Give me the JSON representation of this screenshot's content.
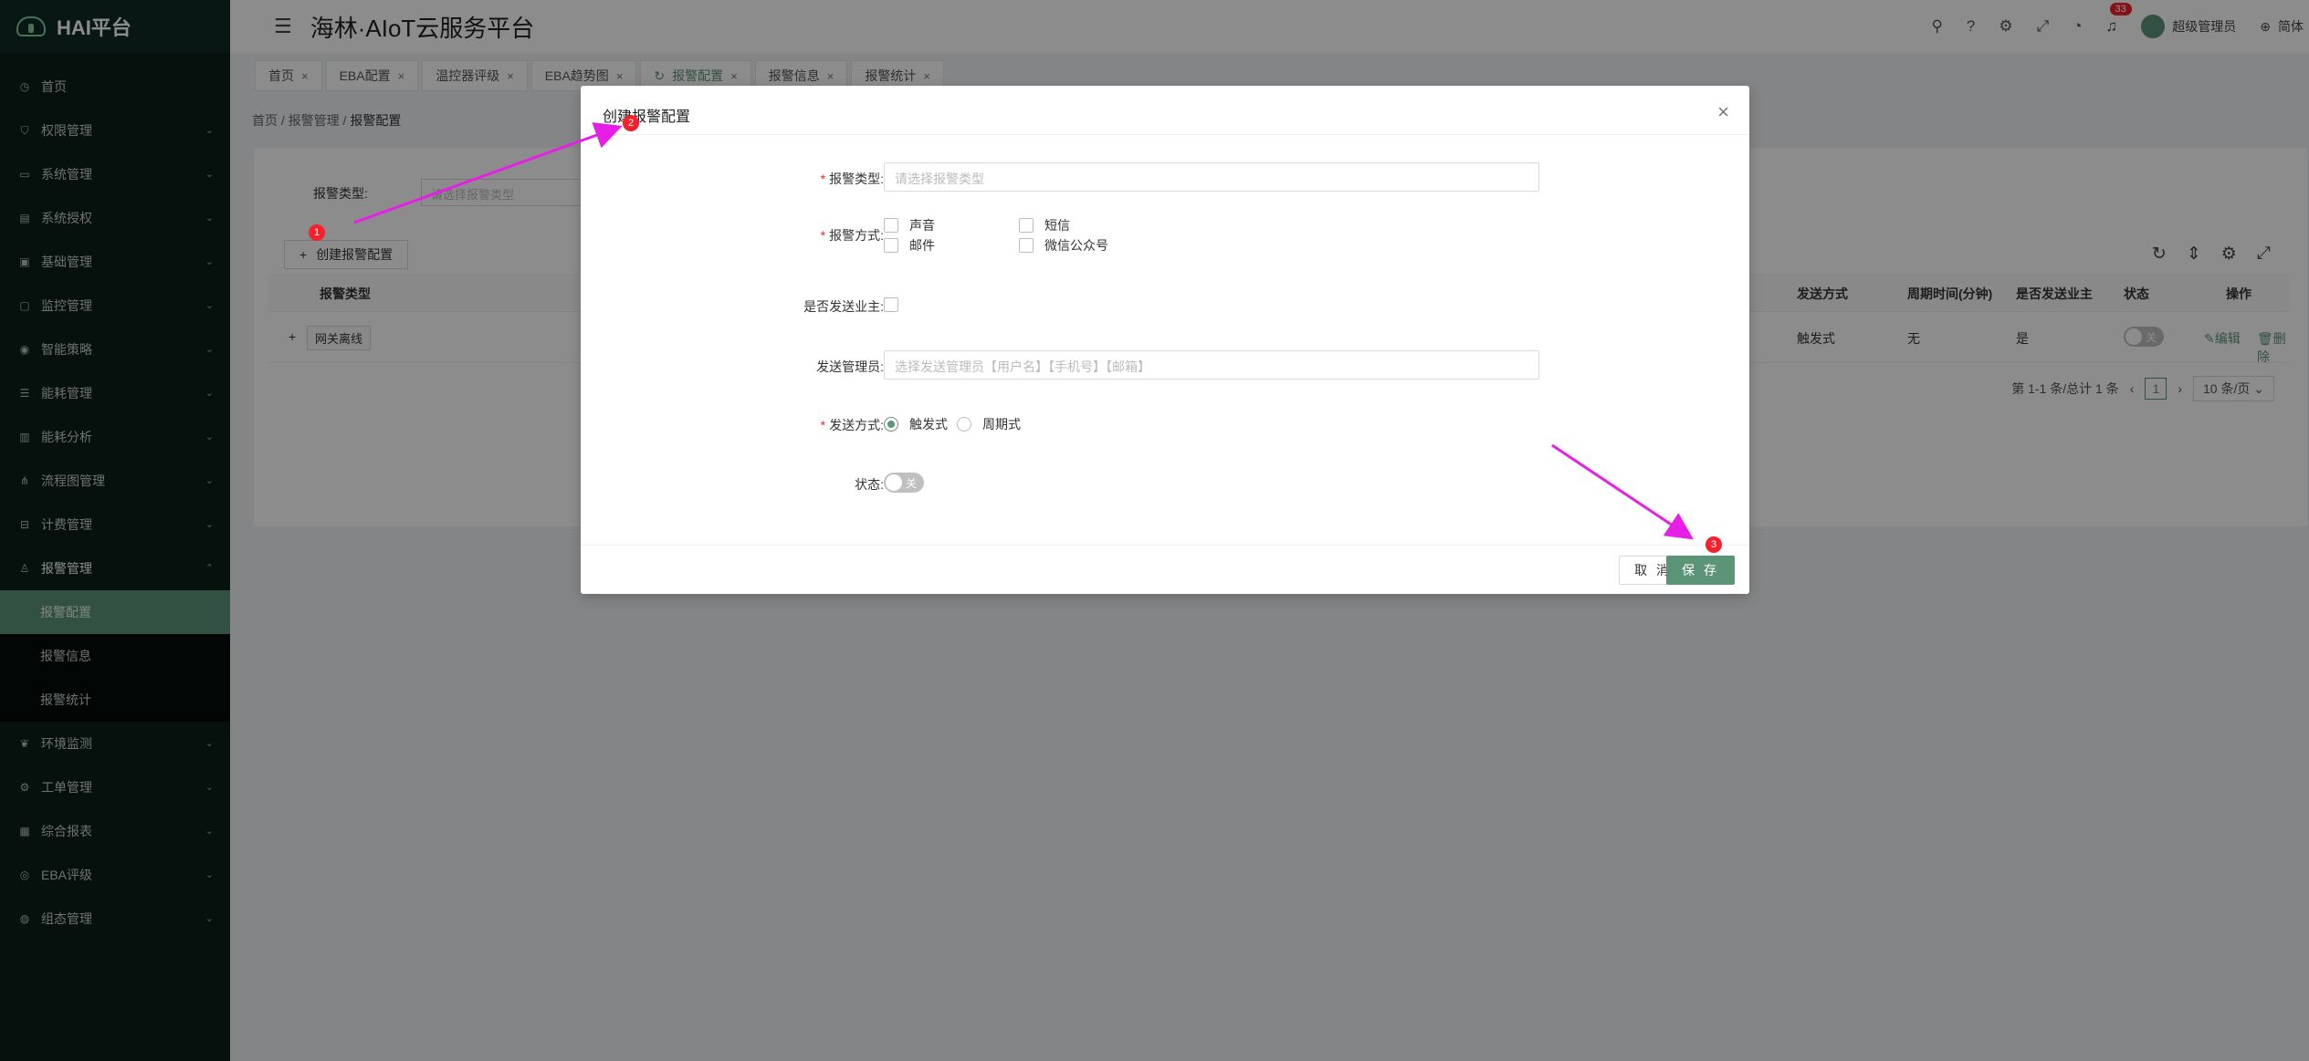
{
  "sidebar": {
    "brand": "HAI平台",
    "items": [
      {
        "label": "首页",
        "icon": "clock-icon",
        "expand": false
      },
      {
        "label": "权限管理",
        "icon": "shield-icon",
        "expand": true
      },
      {
        "label": "系统管理",
        "icon": "monitor-icon",
        "expand": true
      },
      {
        "label": "系统授权",
        "icon": "document-icon",
        "expand": true
      },
      {
        "label": "基础管理",
        "icon": "image-icon",
        "expand": true
      },
      {
        "label": "监控管理",
        "icon": "screen-icon",
        "expand": true
      },
      {
        "label": "智能策略",
        "icon": "bulb-icon",
        "expand": true
      },
      {
        "label": "能耗管理",
        "icon": "sliders-icon",
        "expand": true
      },
      {
        "label": "能耗分析",
        "icon": "bar-chart-icon",
        "expand": true
      },
      {
        "label": "流程图管理",
        "icon": "flow-icon",
        "expand": true
      },
      {
        "label": "计费管理",
        "icon": "money-icon",
        "expand": true
      },
      {
        "label": "报警管理",
        "icon": "alarm-icon",
        "expand": true
      }
    ],
    "sub_items": [
      "报警配置",
      "报警信息",
      "报警统计"
    ],
    "items_after": [
      {
        "label": "环境监测",
        "icon": "leaf-icon"
      },
      {
        "label": "工单管理",
        "icon": "gear-icon"
      },
      {
        "label": "综合报表",
        "icon": "report-icon"
      },
      {
        "label": "EBA评级",
        "icon": "medal-icon"
      },
      {
        "label": "组态管理",
        "icon": "dashboard-icon"
      }
    ]
  },
  "header": {
    "title": "海林·AIoT云服务平台",
    "notification_count": "33",
    "user": "超级管理员",
    "language": "简体"
  },
  "tabs": [
    {
      "label": "首页"
    },
    {
      "label": "EBA配置"
    },
    {
      "label": "温控器评级"
    },
    {
      "label": "EBA趋势图"
    },
    {
      "label": "报警配置",
      "active": true
    },
    {
      "label": "报警信息"
    },
    {
      "label": "报警统计"
    }
  ],
  "breadcrumb": [
    "首页",
    "报警管理",
    "报警配置"
  ],
  "filter": {
    "label": "报警类型:",
    "placeholder": "请选择报警类型"
  },
  "create_button": "创建报警配置",
  "table": {
    "headers": [
      "报警类型",
      "发送方式",
      "周期时间(分钟)",
      "是否发送业主",
      "状态",
      "操作"
    ],
    "row": {
      "expand": "+",
      "type": "网关离线",
      "send_mode": "触发式",
      "period": "无",
      "send_owner": "是",
      "status": "关",
      "edit": "编辑",
      "delete": "删除"
    }
  },
  "pagination": {
    "summary": "第 1-1 条/总计 1 条",
    "page": "1",
    "size": "10 条/页"
  },
  "modal": {
    "title": "创建报警配置",
    "fields": {
      "alarm_type": {
        "label": "报警类型:",
        "placeholder": "请选择报警类型"
      },
      "alarm_method": {
        "label": "报警方式:",
        "options": [
          "声音",
          "短信",
          "邮件",
          "微信公众号"
        ]
      },
      "send_owner": {
        "label": "是否发送业主:"
      },
      "send_admin": {
        "label": "发送管理员:",
        "placeholder": "选择发送管理员【用户名】【手机号】【邮箱】"
      },
      "send_mode": {
        "label": "发送方式:",
        "options": [
          "触发式",
          "周期式"
        ],
        "selected": "触发式"
      },
      "status": {
        "label": "状态:",
        "value": "关"
      }
    },
    "cancel": "取 消",
    "save": "保 存"
  },
  "annotations": [
    "1",
    "2",
    "3"
  ],
  "colors": {
    "accent": "#5c9478",
    "marker": "#f5222d",
    "arrow": "#e61ee6"
  }
}
